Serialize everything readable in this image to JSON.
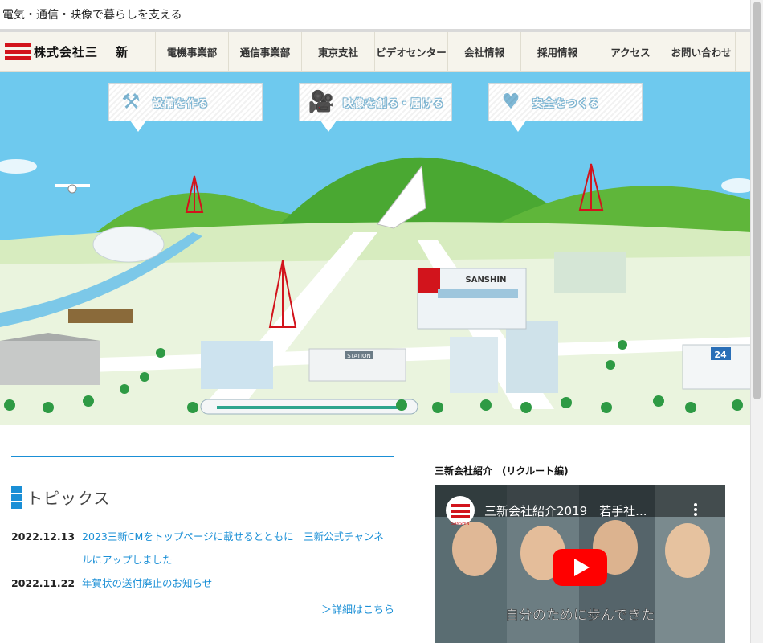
{
  "site": {
    "tagline": "電気・通信・映像で暮らしを支える",
    "logo_text": "株式会社三　 新"
  },
  "nav": {
    "items": [
      "電機事業部",
      "通信事業部",
      "東京支社",
      "ビデオセンター",
      "会社情報",
      "採用情報",
      "アクセス",
      "お問い合わせ"
    ]
  },
  "hero": {
    "bubbles": [
      {
        "label": "設備を作る",
        "icon": "tools-icon"
      },
      {
        "label": "映像を創る・届ける",
        "icon": "video-camera-icon"
      },
      {
        "label": "安全をつくる",
        "icon": "heart-icon"
      }
    ],
    "building_sign": "SANSHIN",
    "station_sign": "STATION",
    "store_sign": "24",
    "colors": {
      "sky": "#6ec9ee",
      "grass": "#8dcf4f",
      "brand_red": "#d2141c"
    }
  },
  "topics": {
    "title": "トピックス",
    "items": [
      {
        "date": "2022.12.13",
        "text": "2023三新CMをトップページに載せるとともに　三新公式チャンネルにアップしました"
      },
      {
        "date": "2022.11.22",
        "text": "年賀状の送付廃止のお知らせ"
      }
    ],
    "more_label": "＞詳細はこちら",
    "accent_color": "#1a8fd6"
  },
  "video": {
    "heading": "三新会社紹介　(リクルート編)",
    "title": "三新会社紹介2019　若手社...",
    "caption": "自分のために歩んできた",
    "channel_badge": "SANSHIN"
  }
}
